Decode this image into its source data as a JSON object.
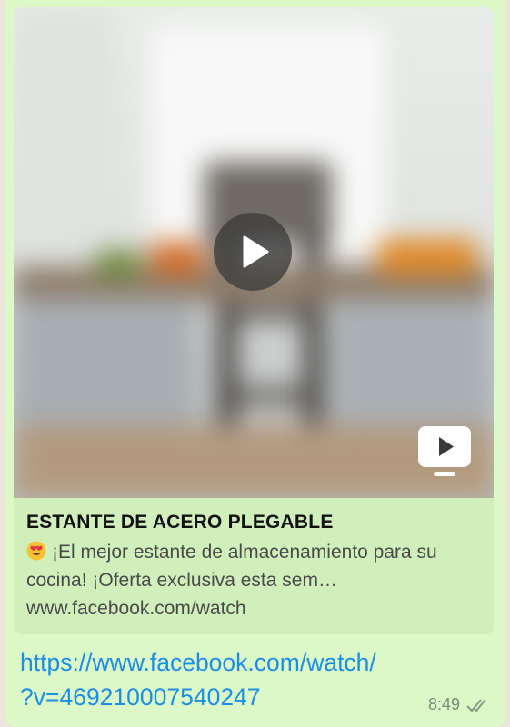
{
  "message": {
    "link_preview": {
      "title": "ESTANTE DE ACERO PLEGABLE",
      "emoji": "😍",
      "description": "¡El mejor estante de almacenamiento para su cocina! ¡Oferta exclusiva esta sem…",
      "domain": "www.facebook.com/watch"
    },
    "url_line1": "https://www.facebook.com/watch/",
    "url_line2": "?v=469210007540247",
    "time": "8:49",
    "status_icon": "double-check-icon"
  },
  "colors": {
    "bubble": "#dcf8c6",
    "card": "#d1efbb",
    "link": "#1c8ee6",
    "meta": "#7e8b7a"
  }
}
